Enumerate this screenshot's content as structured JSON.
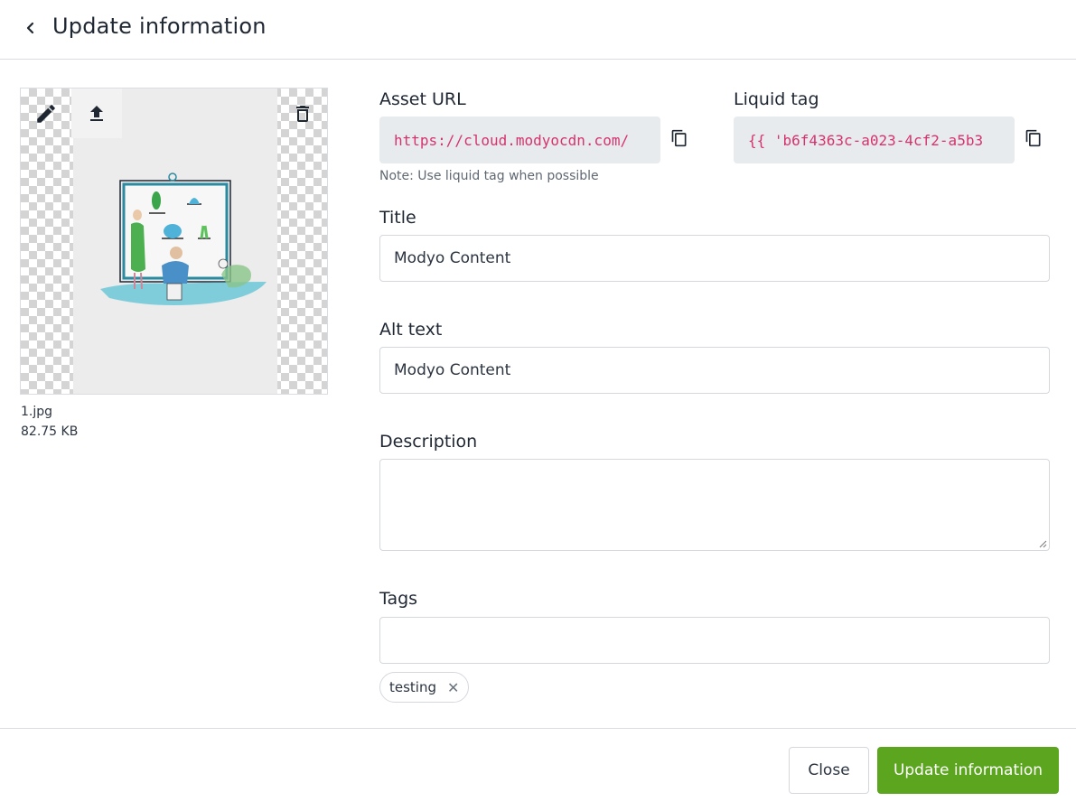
{
  "header": {
    "title": "Update information"
  },
  "preview": {
    "file_name": "1.jpg",
    "file_size": "82.75 KB"
  },
  "form": {
    "asset_url_label": "Asset URL",
    "asset_url_value": "https://cloud.modyocdn.com/",
    "liquid_tag_label": "Liquid tag",
    "liquid_tag_value": "{{ 'b6f4363c-a023-4cf2-a5b3",
    "note": "Note: Use liquid tag when possible",
    "title_label": "Title",
    "title_value": "Modyo Content",
    "alt_label": "Alt text",
    "alt_value": "Modyo Content",
    "description_label": "Description",
    "description_value": "",
    "tags_label": "Tags",
    "tags": [
      "testing"
    ]
  },
  "footer": {
    "close_label": "Close",
    "update_label": "Update information"
  },
  "colors": {
    "accent": "#5ba61e",
    "code": "#d6336c"
  }
}
